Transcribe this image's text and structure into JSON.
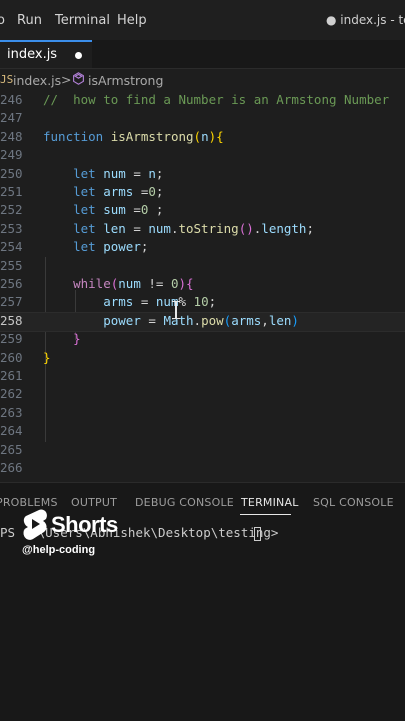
{
  "menubar": {
    "items": [
      "Run",
      "Terminal",
      "Help"
    ],
    "title": "● index.js - testi"
  },
  "tab": {
    "label": "index.js"
  },
  "breadcrumb": {
    "file": "index.js",
    "separator": ">",
    "symbol": "isArmstrong"
  },
  "editor": {
    "lines": [
      {
        "n": "246",
        "tokens": [
          [
            "c",
            "//  how to find a Number is an Armstong Number"
          ]
        ]
      },
      {
        "n": "247",
        "tokens": []
      },
      {
        "n": "248",
        "tokens": [
          [
            "k",
            "function "
          ],
          [
            "f",
            "isArmstrong"
          ],
          [
            "b1",
            "("
          ],
          [
            "v",
            "n"
          ],
          [
            "b1",
            ")"
          ],
          [
            "b1",
            "{"
          ]
        ]
      },
      {
        "n": "249",
        "tokens": []
      },
      {
        "n": "250",
        "tokens": [
          [
            "p",
            "    "
          ],
          [
            "k",
            "let "
          ],
          [
            "v",
            "num"
          ],
          [
            "p",
            " = "
          ],
          [
            "v",
            "n"
          ],
          [
            "p",
            ";"
          ]
        ]
      },
      {
        "n": "251",
        "tokens": [
          [
            "p",
            "    "
          ],
          [
            "k",
            "let "
          ],
          [
            "v",
            "arms"
          ],
          [
            "p",
            " ="
          ],
          [
            "n",
            "0"
          ],
          [
            "p",
            ";"
          ]
        ]
      },
      {
        "n": "252",
        "tokens": [
          [
            "p",
            "    "
          ],
          [
            "k",
            "let "
          ],
          [
            "v",
            "sum"
          ],
          [
            "p",
            " ="
          ],
          [
            "n",
            "0"
          ],
          [
            "p",
            " ;"
          ]
        ]
      },
      {
        "n": "253",
        "tokens": [
          [
            "p",
            "    "
          ],
          [
            "k",
            "let "
          ],
          [
            "v",
            "len"
          ],
          [
            "p",
            " = "
          ],
          [
            "v",
            "num"
          ],
          [
            "p",
            "."
          ],
          [
            "f",
            "toString"
          ],
          [
            "b2",
            "()"
          ],
          [
            "p",
            "."
          ],
          [
            "v",
            "length"
          ],
          [
            "p",
            ";"
          ]
        ]
      },
      {
        "n": "254",
        "tokens": [
          [
            "p",
            "    "
          ],
          [
            "k",
            "let "
          ],
          [
            "v",
            "power"
          ],
          [
            "p",
            ";"
          ]
        ]
      },
      {
        "n": "255",
        "tokens": []
      },
      {
        "n": "256",
        "tokens": [
          [
            "p",
            "    "
          ],
          [
            "x",
            "while"
          ],
          [
            "b2",
            "("
          ],
          [
            "v",
            "num"
          ],
          [
            "p",
            " != "
          ],
          [
            "n",
            "0"
          ],
          [
            "b2",
            ")"
          ],
          [
            "b2",
            "{"
          ]
        ]
      },
      {
        "n": "257",
        "tokens": [
          [
            "p",
            "        "
          ],
          [
            "v",
            "arms"
          ],
          [
            "p",
            " = "
          ],
          [
            "v",
            "num"
          ],
          [
            "p",
            "% "
          ],
          [
            "n",
            "10"
          ],
          [
            "p",
            ";"
          ]
        ]
      },
      {
        "n": "258",
        "tokens": [
          [
            "p",
            "        "
          ],
          [
            "v",
            "power"
          ],
          [
            "p",
            " = "
          ],
          [
            "v",
            "Math"
          ],
          [
            "p",
            "."
          ],
          [
            "f",
            "pow"
          ],
          [
            "b3",
            "("
          ],
          [
            "v",
            "arms"
          ],
          [
            "p",
            ","
          ],
          [
            "v",
            "len"
          ],
          [
            "b3",
            ")"
          ]
        ]
      },
      {
        "n": "259",
        "tokens": [
          [
            "p",
            "    "
          ],
          [
            "b2",
            "}"
          ]
        ]
      },
      {
        "n": "260",
        "tokens": [
          [
            "b1",
            "}"
          ]
        ]
      },
      {
        "n": "261",
        "tokens": []
      },
      {
        "n": "262",
        "tokens": []
      },
      {
        "n": "263",
        "tokens": []
      },
      {
        "n": "264",
        "tokens": []
      },
      {
        "n": "265",
        "tokens": []
      },
      {
        "n": "266",
        "tokens": []
      }
    ],
    "active_line": "258"
  },
  "panel": {
    "tabs": [
      "PROBLEMS",
      "OUTPUT",
      "DEBUG CONSOLE",
      "TERMINAL",
      "SQL CONSOLE"
    ],
    "active_tab": "TERMINAL",
    "terminal_prompt": "PS C:\\Users\\Abhishek\\Desktop\\testing> "
  },
  "watermark": {
    "logo_text": "Shorts",
    "handle": "@help-coding"
  },
  "colors": {
    "background": "#1e1e1e",
    "accent": "#3b8eea",
    "keyword": "#569cd6",
    "function": "#dcdcaa",
    "variable": "#9cdcfe",
    "number": "#b5cea8",
    "comment": "#6a9955"
  }
}
